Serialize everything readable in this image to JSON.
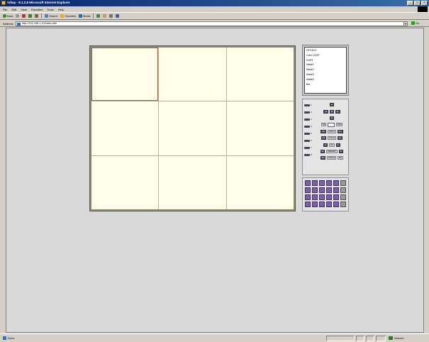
{
  "window": {
    "title": "Vdisp - 8.1.2.8 Microsoft Internet Explorer",
    "controls": [
      "_",
      "□",
      "×"
    ]
  },
  "menubar": {
    "items": [
      "File",
      "Edit",
      "View",
      "Favorites",
      "Tools",
      "Help"
    ]
  },
  "toolbar": {
    "back_label": "Back",
    "search_label": "Search",
    "favorites_label": "Favorites",
    "media_label": "Media"
  },
  "address": {
    "label": "Address",
    "value": "http://192.168.1.10/index.htm",
    "go_label": "Go"
  },
  "camera_list": {
    "items": [
      "GFX3DC",
      "Cam LOOP",
      "DVR1",
      "Mask1",
      "Mask2",
      "Mask3",
      "Mask4",
      "Bla"
    ]
  },
  "ptz": {
    "speeds": [
      "1",
      "2",
      "3",
      "4",
      "5",
      "6",
      "7",
      "8"
    ],
    "rows": [
      [
        "▲"
      ],
      [
        "◄",
        "■",
        "►"
      ],
      [
        "▼"
      ],
      [
        "Tilt",
        "",
        "Pan"
      ],
      [
        "Zm",
        "Zoom",
        "Zm"
      ],
      [
        "Fc",
        "Focus",
        "Fc"
      ],
      [
        "Ir",
        "Iris",
        "Ir"
      ],
      [
        "Pr",
        "PRESET",
        "Pr"
      ],
      [
        "Sv",
        "Cancel",
        "Set"
      ]
    ]
  },
  "layouts": {
    "buttons": 24
  },
  "statusbar": {
    "text": "Done",
    "zone": "Internet"
  }
}
